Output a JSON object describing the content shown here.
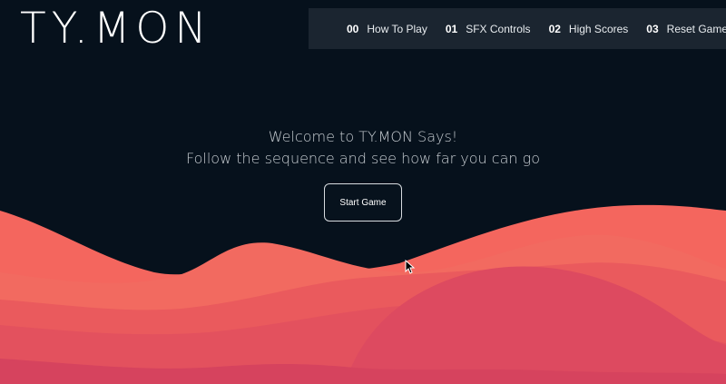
{
  "brand": {
    "logo_text": "TY.MON"
  },
  "nav": {
    "items": [
      {
        "num": "00",
        "label": "How To Play"
      },
      {
        "num": "01",
        "label": "SFX Controls"
      },
      {
        "num": "02",
        "label": "High Scores"
      },
      {
        "num": "03",
        "label": "Reset Game"
      }
    ]
  },
  "hero": {
    "line1": "Welcome to TY.MON Says!",
    "line2": "Follow the sequence and see how far you can go",
    "start_label": "Start Game"
  },
  "colors": {
    "background": "#06111c",
    "nav_background": "#1b2530",
    "wave_light": "#f4665e",
    "wave_mid": "#ea5a5d",
    "wave_dark": "#dd4a60"
  },
  "icons": {
    "cursor": "mouse-pointer-icon"
  }
}
